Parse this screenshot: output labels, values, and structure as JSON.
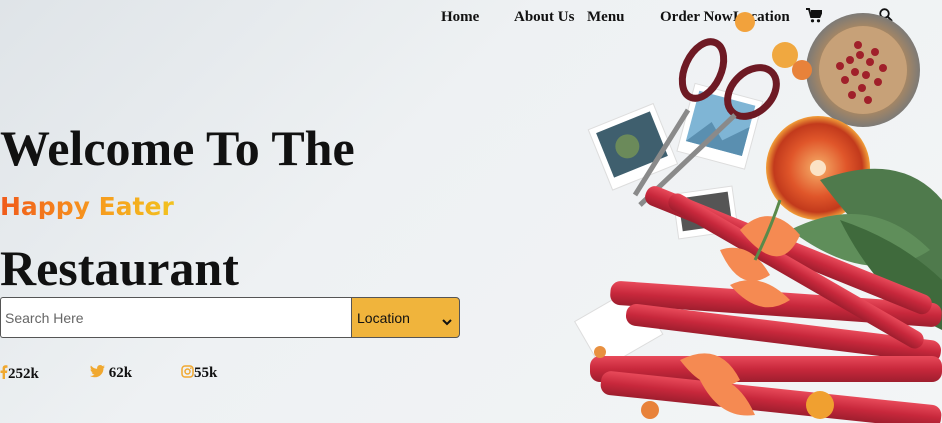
{
  "nav": {
    "items": [
      {
        "label": "Home"
      },
      {
        "label": "About Us"
      },
      {
        "label": "Menu"
      },
      {
        "label": "Order Now"
      },
      {
        "label": "Location"
      }
    ],
    "cart_icon": "cart-icon",
    "search_icon": "search-icon"
  },
  "hero": {
    "line1": "Welcome To The",
    "brand": "Happy Eater",
    "line3": "Restaurant"
  },
  "search": {
    "placeholder": "Search Here",
    "value": "",
    "location_selected": "Location"
  },
  "social": [
    {
      "icon": "facebook-icon",
      "count": "252k"
    },
    {
      "icon": "twitter-icon",
      "count": "62k"
    },
    {
      "icon": "instagram-icon",
      "count": "55k"
    }
  ],
  "colors": {
    "brand_start": "#f05a1a",
    "brand_end": "#f2c21f",
    "accent": "#f0b43c",
    "social_icon": "#f0a830"
  }
}
